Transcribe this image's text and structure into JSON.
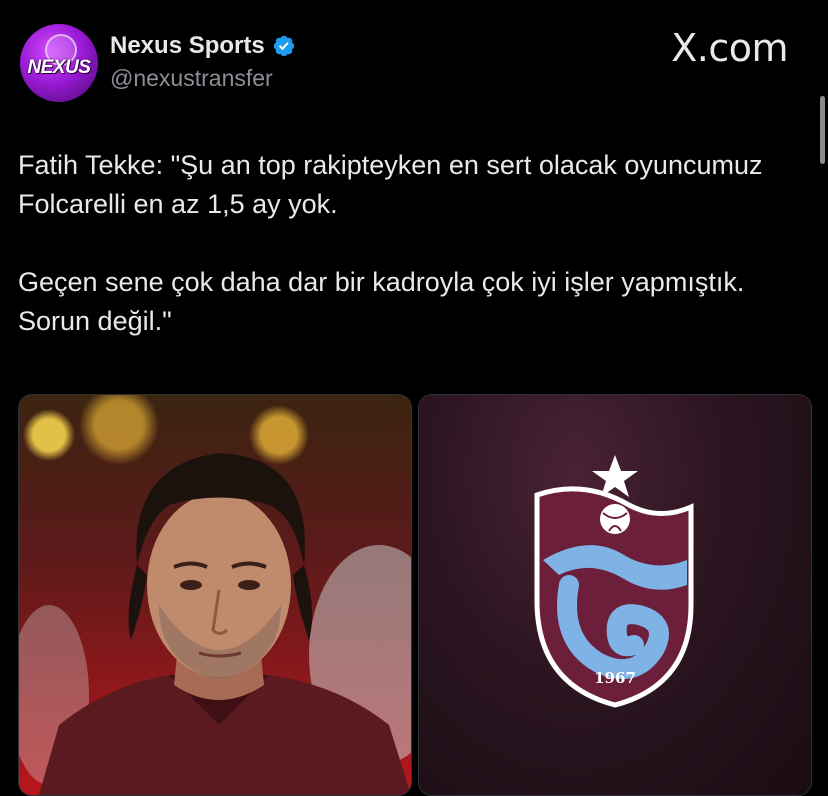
{
  "author": {
    "display_name": "Nexus Sports",
    "handle": "@nexustransfer",
    "avatar_text": "NEXUS",
    "verified": true
  },
  "site_watermark": "X.com",
  "tweet": {
    "paragraphs": [
      "Fatih Tekke: \"Şu an top rakipteyken en sert olacak oyuncumuz Folcarelli en az 1,5 ay yok.",
      "Geçen sene çok daha dar bir kadroyla çok iyi işler yapmıştık. Sorun değil.\""
    ]
  },
  "media": {
    "badge_year": "1967"
  },
  "colors": {
    "background": "#000000",
    "text": "#e7e9ea",
    "secondary_text": "#8b9097",
    "verified_blue": "#1d9bf0",
    "club_claret": "#6b1f3a",
    "club_blue": "#7fb2e5"
  }
}
